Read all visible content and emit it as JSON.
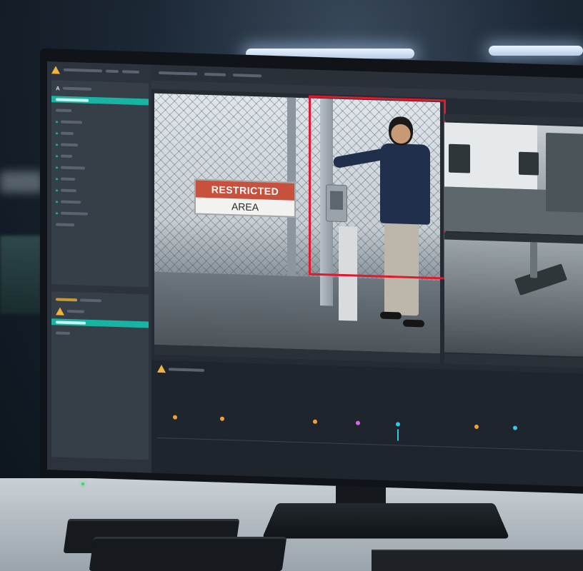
{
  "sign": {
    "line1": "RESTRICTED",
    "line2": "AREA"
  },
  "colors": {
    "accent": "#19b3a3",
    "detection_box": "#e0192f",
    "warning": "#f0b43c",
    "marker_orange": "#f0a040",
    "marker_magenta": "#d868e0",
    "marker_cyan": "#38c8e6"
  },
  "icons": [
    "warning-icon",
    "app-logo-icon",
    "camera-feed-icon",
    "detection-box"
  ],
  "timeline": {
    "markers": [
      {
        "color": "#f0a040"
      },
      {
        "color": "#f0a040"
      },
      {
        "color": "#f0a040"
      },
      {
        "color": "#d868e0"
      },
      {
        "color": "#38c8e6"
      },
      {
        "color": "#f0a040"
      },
      {
        "color": "#38c8e6"
      }
    ]
  }
}
